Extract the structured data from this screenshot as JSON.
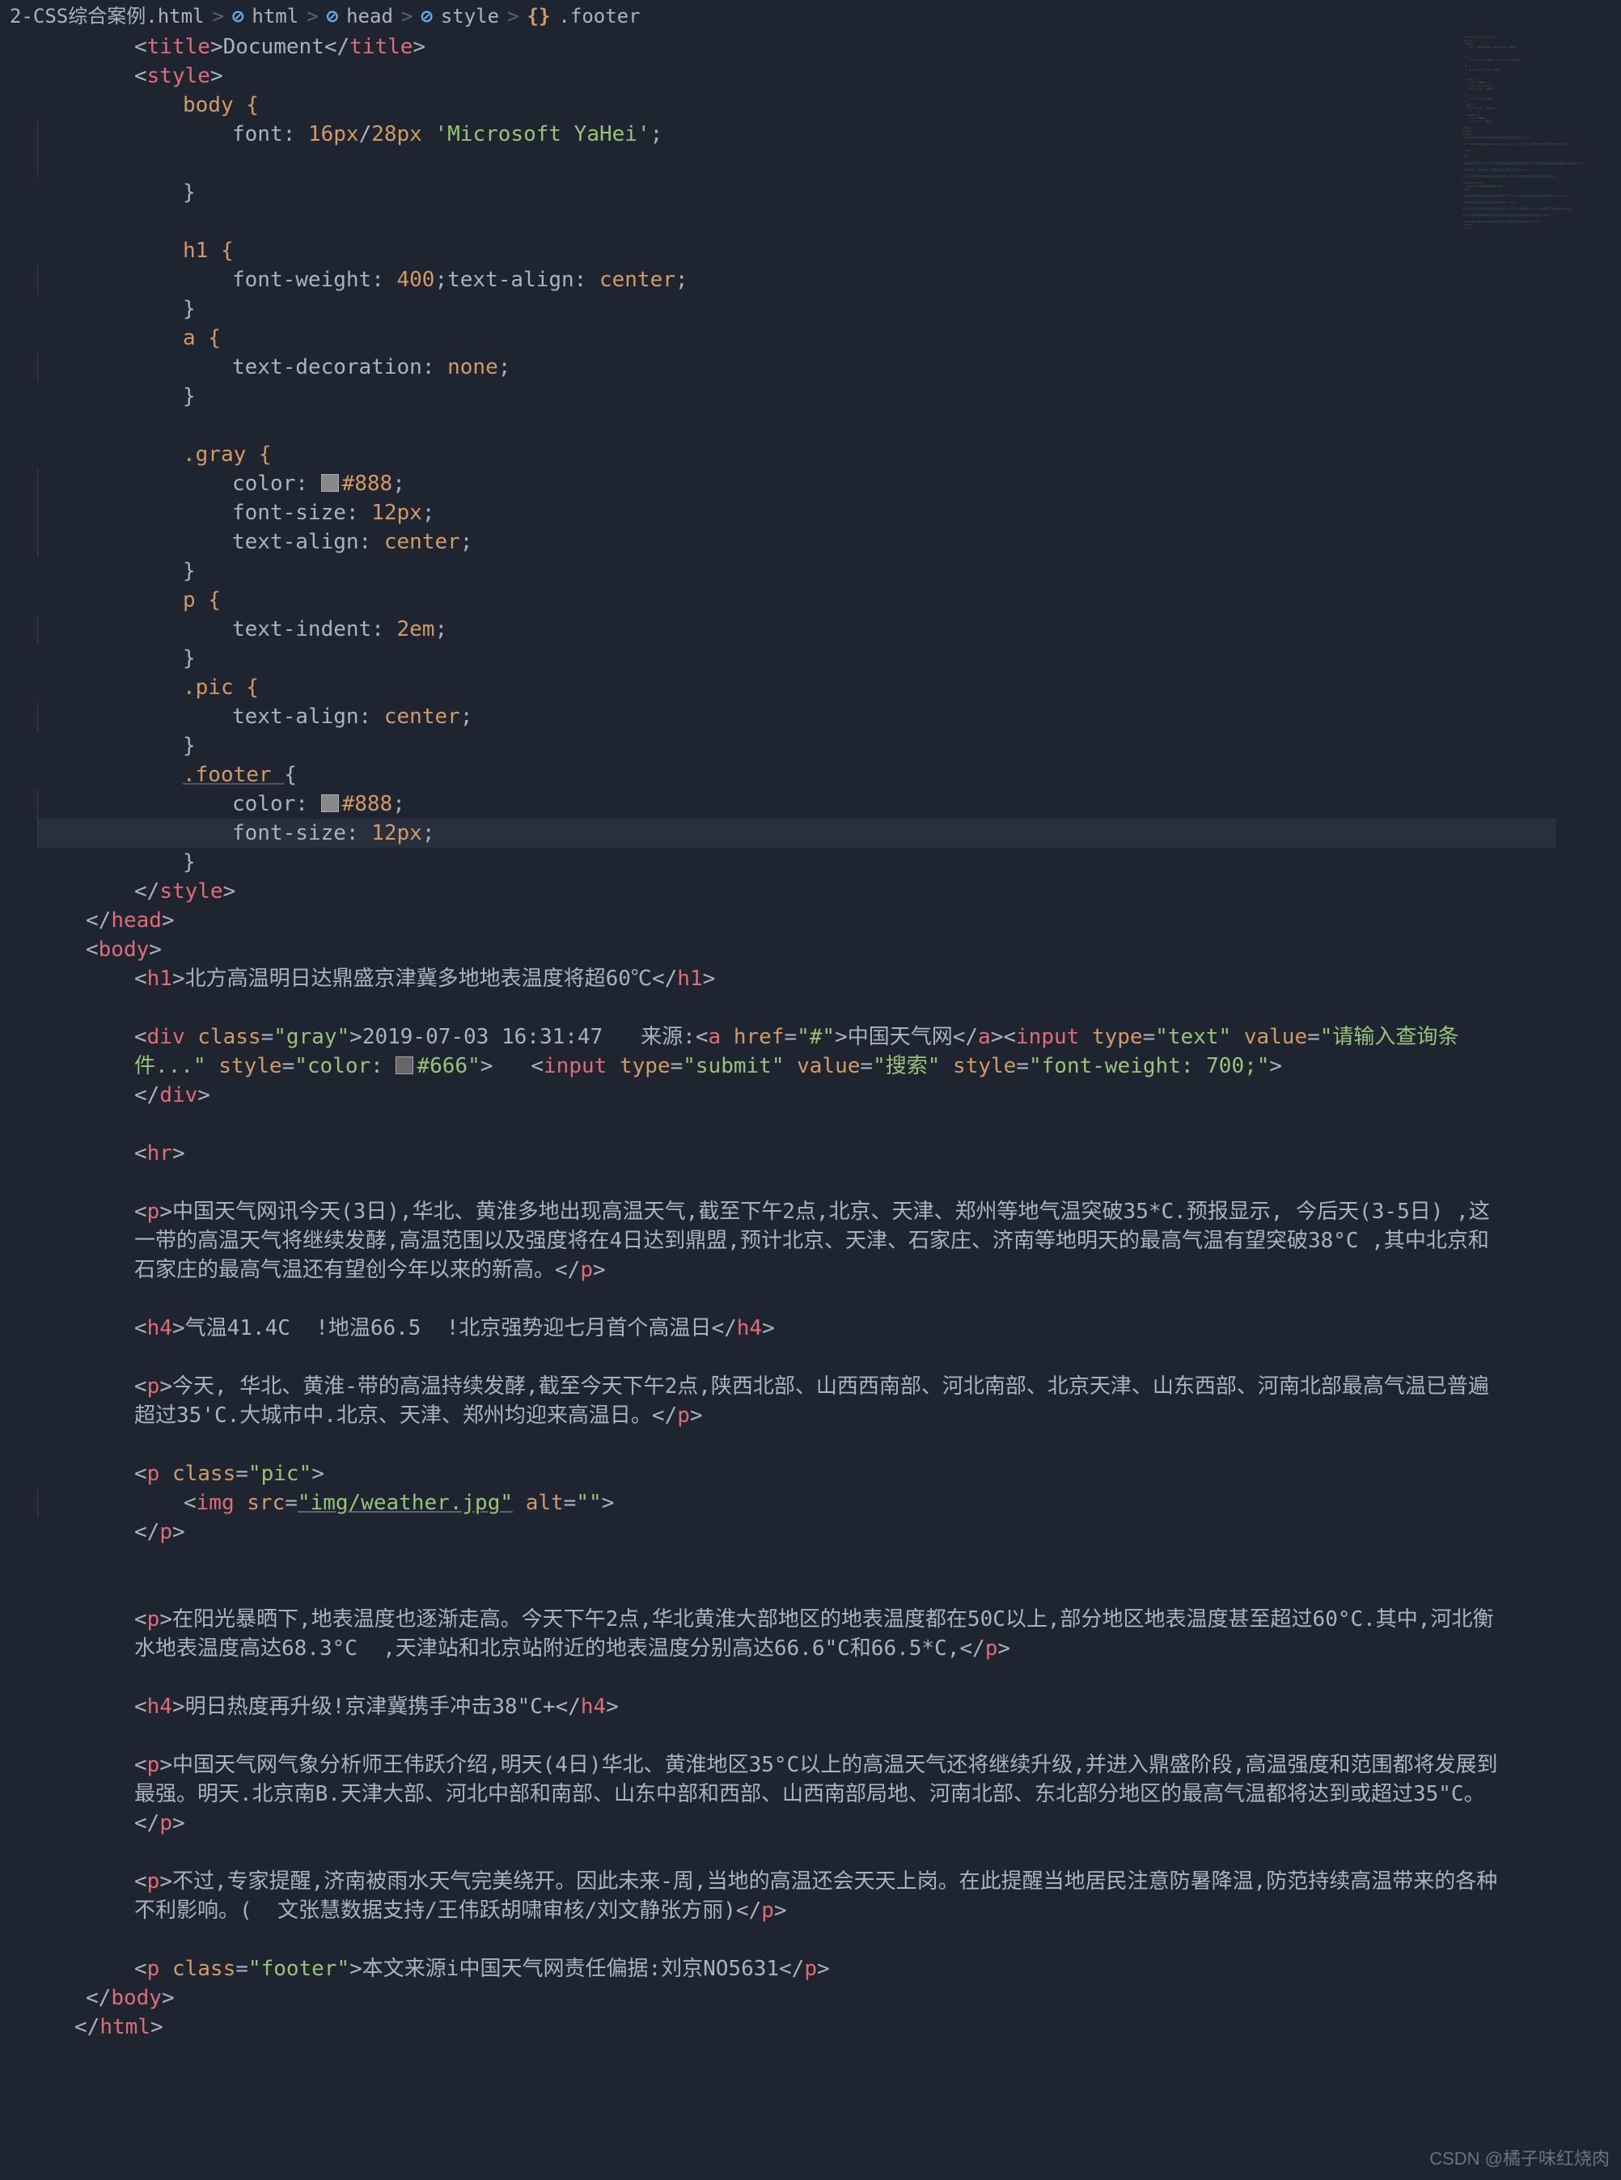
{
  "breadcrumb": {
    "file": "2-CSS综合案例.html",
    "items": [
      "html",
      "head",
      "style",
      ".footer"
    ]
  },
  "code": {
    "title_tag": "title",
    "title_text": "Document",
    "style_tag": "style",
    "body_sel": "body {",
    "body_font_prop": "font",
    "body_font_val_a": "16px",
    "body_font_slash": "/",
    "body_font_val_b": "28px",
    "body_font_str": "'Microsoft YaHei'",
    "h1_sel": "h1 {",
    "h1_fw_prop": "font-weight",
    "h1_fw_val": "400",
    "h1_ta_prop": "text-align",
    "h1_ta_val": "center",
    "a_sel": "a {",
    "a_td_prop": "text-decoration",
    "a_td_val": "none",
    "gray_sel": ".gray {",
    "color_prop": "color",
    "color_val": "#888",
    "fs_prop": "font-size",
    "fs_val": "12px",
    "ta_prop": "text-align",
    "ta_val": "center",
    "p_sel": "p {",
    "ti_prop": "text-indent",
    "ti_val": "2em",
    "pic_sel": ".pic {",
    "footer_sel": ".footer ",
    "footer_brace": "{",
    "head_tag": "head",
    "body_tag": "body",
    "h1_tag": "h1",
    "h1_text": "北方高温明日达鼎盛京津冀多地地表温度将超60℃",
    "div_tag": "div",
    "class_attr": "class",
    "gray_class": "gray",
    "gray_text": "2019-07-03 16:31:47   来源:",
    "a_tag": "a",
    "href_attr": "href",
    "href_val": "#",
    "a_text": "中国天气网",
    "input_tag": "input",
    "type_attr": "type",
    "type_text": "text",
    "value_attr": "value",
    "value_text": "请输入查询条件...",
    "style_attr": "style",
    "style_val1": "color: ",
    "style_val1_color": "#666",
    "type_submit": "submit",
    "value_submit": "搜索",
    "style_val2": "font-weight: 700;",
    "hr_tag": "hr",
    "p_tag": "p",
    "p1_text": "中国天气网讯今天(3日),华北、黄淮多地出现高温天气,截至下午2点,北京、天津、郑州等地气温突破35*C.预报显示, 今后天(3-5日) ,这一带的高温天气将继续发酵,高温范围以及强度将在4日达到鼎盟,预计北京、天津、石家庄、济南等地明天的最高气温有望突破38°C ,其中北京和石家庄的最高气温还有望创今年以来的新高。",
    "h4_tag": "h4",
    "h4_1_text": "气温41.4C  !地温66.5  !北京强势迎七月首个高温日",
    "p2_text": "今天, 华北、黄淮-带的高温持续发酵,截至今天下午2点,陕西北部、山西西南部、河北南部、北京天津、山东西部、河南北部最高气温已普遍超过35'C.大城市中.北京、天津、郑州均迎来高温日。",
    "pic_class": "pic",
    "img_tag": "img",
    "src_attr": "src",
    "src_val": "img/weather.jpg",
    "alt_attr": "alt",
    "alt_val": "",
    "p3_text": "在阳光暴晒下,地表温度也逐渐走高。今天下午2点,华北黄淮大部地区的地表温度都在50C以上,部分地区地表温度甚至超过60°C.其中,河北衡水地表温度高达68.3°C  ,天津站和北京站附近的地表温度分别高达66.6\"C和66.5*C,",
    "h4_2_text": "明日热度再升级!京津冀携手冲击38\"C+",
    "p4_text": "中国天气网气象分析师王伟跃介绍,明天(4日)华北、黄淮地区35°C以上的高温天气还将继续升级,并进入鼎盛阶段,高温强度和范围都将发展到最强。明天.北京南B.天津大部、河北中部和南部、山东中部和西部、山西南部局地、河南北部、东北部分地区的最高气温都将达到或超过35\"C。",
    "p5_text": "不过,专家提醒,济南被雨水天气完美绕开。因此未来-周,当地的高温还会天天上岗。在此提醒当地居民注意防暑降温,防范持续高温带来的各种不利影响。(  文张慧数据支持/王伟跃胡啸审核/刘文静张方丽)",
    "footer_class": "footer",
    "footer_text": "本文来源i中国天气网责任偏据:刘京NO5631",
    "html_tag": "html"
  },
  "watermark": "CSDN @橘子味红烧肉"
}
